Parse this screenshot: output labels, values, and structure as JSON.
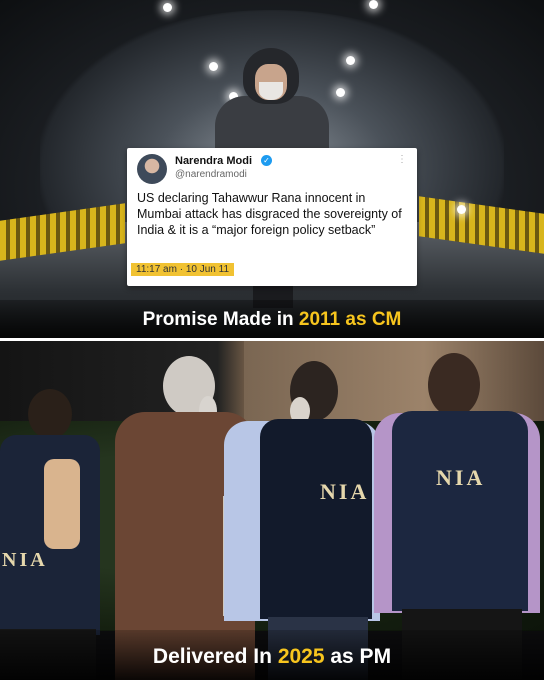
{
  "tweet": {
    "name": "Narendra Modi",
    "handle": "@narendramodi",
    "text": "US declaring Tahawwur Rana innocent in Mumbai attack has disgraced the sovereignty of India & it is a “major foreign policy setback”",
    "timestamp": "11:17 am · 10 Jun 11",
    "more_glyph": "⋮",
    "verified_glyph": "✓"
  },
  "caption_top": {
    "prefix": "Promise Made in ",
    "highlight": "2011 as CM"
  },
  "caption_bottom": {
    "prefix": "Delivered In ",
    "highlight": "2025",
    "suffix": " as PM"
  },
  "jackets": {
    "left": "NIA",
    "center": "NIA",
    "right": "NIA"
  },
  "colors": {
    "highlight": "#f7c51e",
    "timestamp_bg": "#f1c232",
    "verified": "#1d9bf0"
  }
}
